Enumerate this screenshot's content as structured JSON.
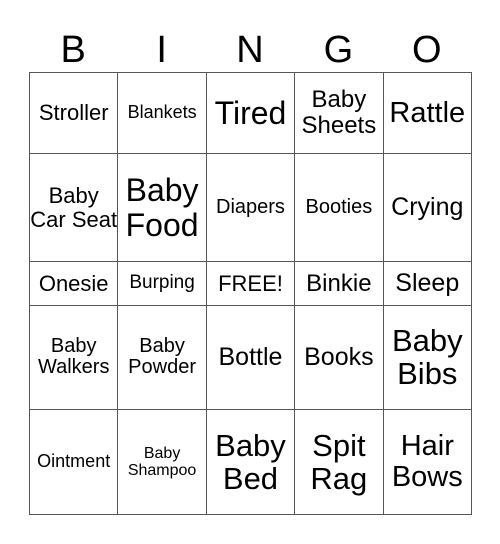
{
  "header": [
    "B",
    "I",
    "N",
    "G",
    "O"
  ],
  "rows": [
    [
      "Stroller",
      "Blankets",
      "Tired",
      "Baby Sheets",
      "Rattle"
    ],
    [
      "Baby Car Seat",
      "Baby Food",
      "Diapers",
      "Booties",
      "Crying"
    ],
    [
      "Onesie",
      "Burping",
      "FREE!",
      "Binkie",
      "Sleep"
    ],
    [
      "Baby Walkers",
      "Baby Powder",
      "Bottle",
      "Books",
      "Baby Bibs"
    ],
    [
      "Ointment",
      "Baby Shampoo",
      "Baby Bed",
      "Spit Rag",
      "Hair Bows"
    ]
  ],
  "colors": {
    "border": "#555555",
    "text": "#000000",
    "background": "#ffffff"
  }
}
